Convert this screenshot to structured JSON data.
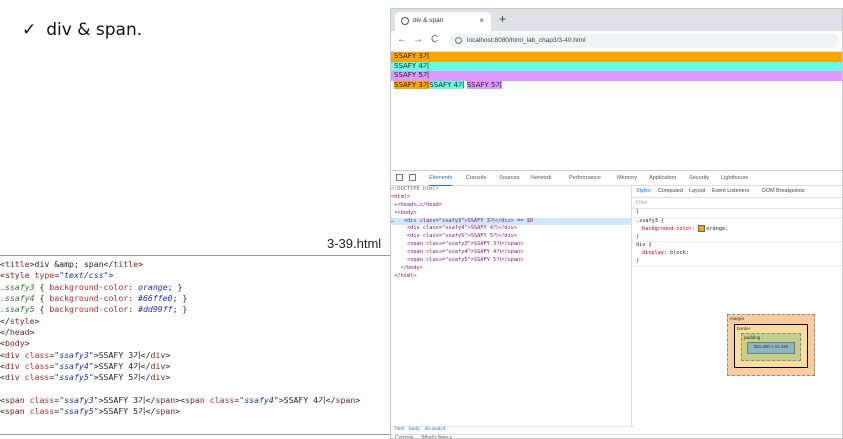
{
  "slide": {
    "title": "div & span.",
    "check": "✓",
    "file_label": "3-39.html"
  },
  "code": {
    "lines": [
      [
        [
          "t-txt",
          "<"
        ],
        [
          "t-tag",
          "title"
        ],
        [
          "t-txt",
          ">div &amp; span</"
        ],
        [
          "t-tag",
          "title"
        ],
        [
          "t-txt",
          ">"
        ]
      ],
      [
        [
          "t-txt",
          "<"
        ],
        [
          "t-tag",
          "style"
        ],
        [
          "t-txt",
          " "
        ],
        [
          "t-attr",
          "type"
        ],
        [
          "t-txt",
          "="
        ],
        [
          "t-str",
          "\"text/css\""
        ],
        [
          "t-txt",
          ">"
        ]
      ],
      [
        [
          "t-sel",
          ".ssafy3"
        ],
        [
          "t-txt",
          " { "
        ],
        [
          "t-attr",
          "background-color"
        ],
        [
          "t-txt",
          ": "
        ],
        [
          "t-val",
          "orange"
        ],
        [
          "t-txt",
          "; }"
        ]
      ],
      [
        [
          "t-sel",
          ".ssafy4"
        ],
        [
          "t-txt",
          " { "
        ],
        [
          "t-attr",
          "background-color"
        ],
        [
          "t-txt",
          ": "
        ],
        [
          "t-val",
          "#66ffe0"
        ],
        [
          "t-txt",
          "; }"
        ]
      ],
      [
        [
          "t-sel",
          ".ssafy5"
        ],
        [
          "t-txt",
          " { "
        ],
        [
          "t-attr",
          "background-color"
        ],
        [
          "t-txt",
          ": "
        ],
        [
          "t-val",
          "#dd99ff"
        ],
        [
          "t-txt",
          "; }"
        ]
      ],
      [
        [
          "t-txt",
          "</"
        ],
        [
          "t-tag",
          "style"
        ],
        [
          "t-txt",
          ">"
        ]
      ],
      [
        [
          "t-txt",
          "</"
        ],
        [
          "t-tag",
          "head"
        ],
        [
          "t-txt",
          ">"
        ]
      ],
      [
        [
          "t-txt",
          "<"
        ],
        [
          "t-tag",
          "body"
        ],
        [
          "t-txt",
          ">"
        ]
      ],
      [
        [
          "t-txt",
          "<"
        ],
        [
          "t-tag",
          "div"
        ],
        [
          "t-txt",
          " "
        ],
        [
          "t-attr",
          "class"
        ],
        [
          "t-txt",
          "="
        ],
        [
          "t-str",
          "\"ssafy3\""
        ],
        [
          "t-txt",
          ">SSAFY 3기</"
        ],
        [
          "t-tag",
          "div"
        ],
        [
          "t-txt",
          ">"
        ]
      ],
      [
        [
          "t-txt",
          "<"
        ],
        [
          "t-tag",
          "div"
        ],
        [
          "t-txt",
          " "
        ],
        [
          "t-attr",
          "class"
        ],
        [
          "t-txt",
          "="
        ],
        [
          "t-str",
          "\"ssafy4\""
        ],
        [
          "t-txt",
          ">SSAFY 4기</"
        ],
        [
          "t-tag",
          "div"
        ],
        [
          "t-txt",
          ">"
        ]
      ],
      [
        [
          "t-txt",
          "<"
        ],
        [
          "t-tag",
          "div"
        ],
        [
          "t-txt",
          " "
        ],
        [
          "t-attr",
          "class"
        ],
        [
          "t-txt",
          "="
        ],
        [
          "t-str",
          "\"ssafy5\""
        ],
        [
          "t-txt",
          ">SSAFY 5기</"
        ],
        [
          "t-tag",
          "div"
        ],
        [
          "t-txt",
          ">"
        ]
      ],
      [],
      [
        [
          "t-txt",
          "<"
        ],
        [
          "t-tag",
          "span"
        ],
        [
          "t-txt",
          " "
        ],
        [
          "t-attr",
          "class"
        ],
        [
          "t-txt",
          "="
        ],
        [
          "t-str",
          "\"ssafy3\""
        ],
        [
          "t-txt",
          ">SSAFY 3기</"
        ],
        [
          "t-tag",
          "span"
        ],
        [
          "t-txt",
          "><"
        ],
        [
          "t-tag",
          "span"
        ],
        [
          "t-txt",
          " "
        ],
        [
          "t-attr",
          "class"
        ],
        [
          "t-txt",
          "="
        ],
        [
          "t-str",
          "\"ssafy4\""
        ],
        [
          "t-txt",
          ">SSAFY 4기</"
        ],
        [
          "t-tag",
          "span"
        ],
        [
          "t-txt",
          ">"
        ]
      ],
      [
        [
          "t-txt",
          "<"
        ],
        [
          "t-tag",
          "span"
        ],
        [
          "t-txt",
          " "
        ],
        [
          "t-attr",
          "class"
        ],
        [
          "t-txt",
          "="
        ],
        [
          "t-str",
          "\"ssafy5\""
        ],
        [
          "t-txt",
          ">SSAFY 5기</"
        ],
        [
          "t-tag",
          "span"
        ],
        [
          "t-txt",
          ">"
        ]
      ]
    ]
  },
  "browser": {
    "tab_title": "div & span",
    "tab_close": "×",
    "new_tab": "+",
    "back": "←",
    "forward": "→",
    "reload": "C",
    "url": "localhost:8080/html_lab_chap3/3-40.html",
    "page": {
      "blocks": [
        "SSAFY 3기",
        "SSAFY 4기",
        "SSAFY 5기"
      ],
      "inline": [
        "SSAFY 3기",
        "SSAFY 4기",
        "SSAFY 5기"
      ]
    },
    "colors": {
      "ssafy3": "#ffa500",
      "ssafy4": "#66ffe0",
      "ssafy5": "#dd99ff"
    }
  },
  "devtools": {
    "tabs": [
      "Elements",
      "Console",
      "Sources",
      "Network",
      "Performance",
      "Memory",
      "Application",
      "Security",
      "Lighthouse"
    ],
    "active_tab": "Elements",
    "dom": [
      {
        "text": "<!DOCTYPE html>",
        "cls": "dom-comment"
      },
      {
        "text": "<html>",
        "cls": "dom-tag"
      },
      {
        "text": " ▸<head>…</head>",
        "cls": "dom-tag"
      },
      {
        "text": " ▾<body>",
        "cls": "dom-tag"
      },
      {
        "text": "…   <div class=\"ssafy3\">SSAFY 3기</div> == $0",
        "cls": "dom-tag",
        "selected": true
      },
      {
        "text": "     <div class=\"ssafy4\">SSAFY 4기</div>",
        "cls": "dom-tag"
      },
      {
        "text": "     <div class=\"ssafy5\">SSAFY 5기</div>",
        "cls": "dom-tag"
      },
      {
        "text": "     <span class=\"ssafy3\">SSAFY 3기</span>",
        "cls": "dom-tag"
      },
      {
        "text": "     <span class=\"ssafy4\">SSAFY 4기</span>",
        "cls": "dom-tag"
      },
      {
        "text": "     <span class=\"ssafy5\">SSAFY 5기</span>",
        "cls": "dom-tag"
      },
      {
        "text": "   </body>",
        "cls": "dom-tag"
      },
      {
        "text": " </html>",
        "cls": "dom-tag"
      }
    ],
    "styles_tabs": [
      "Styles",
      "Computed",
      "Layout",
      "Event Listeners",
      "DOM Breakpoints"
    ],
    "filter_placeholder": "Filter",
    "rules": {
      "element_rule": "}",
      "ssafy3_selector": ".ssafy3 {",
      "ssafy3_prop": "background-color:",
      "ssafy3_val": "orange;",
      "ssafy3_close": "}",
      "div_selector": "div {",
      "div_prop": "display:",
      "div_val": "block;",
      "div_close": "}"
    },
    "box_model": {
      "margin_label": "margin",
      "border_label": "border",
      "padding_label": "padding -",
      "content_size": "351.400 × 21.440",
      "dash": "-"
    },
    "breadcrumbs": [
      "html",
      "body",
      "div.ssafy3"
    ],
    "drawer": [
      "Console",
      "What's New ×"
    ]
  }
}
